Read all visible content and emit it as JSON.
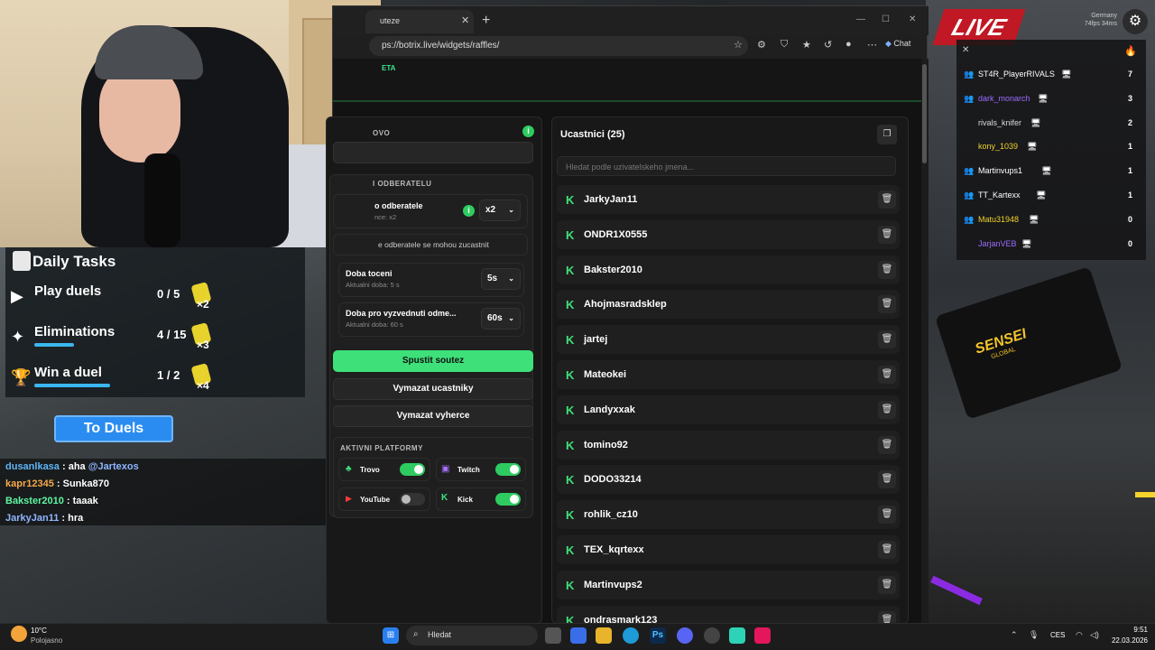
{
  "game": {
    "location": "Germany",
    "fps_ping": "74fps 34ms",
    "banner": "LIVE",
    "sensei_label": "SENSEI",
    "sensei_sub": "GLOBAL"
  },
  "daily_tasks": {
    "title": "Daily Tasks",
    "tasks": [
      {
        "label": "Play duels",
        "progress": "0 / 5",
        "multiplier": "×2",
        "fraction": 0.0
      },
      {
        "label": "Eliminations",
        "progress": "4 / 15",
        "multiplier": "×3",
        "fraction": 0.27
      },
      {
        "label": "Win a duel",
        "progress": "1 / 2",
        "multiplier": "×4",
        "fraction": 0.5
      }
    ],
    "button": "To Duels"
  },
  "chat": [
    {
      "user": "dusanlkasa",
      "text": " : aha ",
      "mention": "@Jartexos",
      "color": "#5fb4f5"
    },
    {
      "user": "kapr12345",
      "text": " : Sunka870",
      "mention": "",
      "color": "#f5a94a"
    },
    {
      "user": "Bakster2010",
      "text": " : taaak",
      "mention": "",
      "color": "#5ff5a0"
    },
    {
      "user": "JarkyJan11",
      "text": " : hra",
      "mention": "",
      "color": "#8fb6ff"
    }
  ],
  "browser": {
    "tab_title": "uteze",
    "url": "ps://botrix.live/widgets/raffles/",
    "chat_label": "Chat",
    "brand": "ETA"
  },
  "settings": {
    "top_label": "OVO",
    "section_subscribers": "I ODBERATELU",
    "subscriber_luck_label": "o odberatele",
    "subscriber_luck_sub": "nce: x2",
    "subscriber_luck_value": "x2",
    "only_subs_text": "e odberatele se mohou zucastnit",
    "spin_time_label": "Doba toceni",
    "spin_time_sub": "Aktualni doba: 5 s",
    "spin_time_value": "5s",
    "claim_time_label": "Doba pro vyzvednuti odme...",
    "claim_time_sub": "Aktualni doba: 60 s",
    "claim_time_value": "60s",
    "start_button": "Spustit soutez",
    "clear_participants": "Vymazat ucastniky",
    "clear_winners": "Vymazat vyherce",
    "platforms_head": "AKTIVNI PLATFORMY",
    "platforms": [
      {
        "name": "Trovo",
        "on": true
      },
      {
        "name": "Twitch",
        "on": true
      },
      {
        "name": "YouTube",
        "on": false
      },
      {
        "name": "Kick",
        "on": true
      }
    ]
  },
  "participants": {
    "title": "Ucastnici (25)",
    "search_placeholder": "Hledat podle uzivatelskeho jmena...",
    "list": [
      "JarkyJan11",
      "ONDR1X0555",
      "Bakster2010",
      "Ahojmasradsklep",
      "jartej",
      "Mateokei",
      "Landyxxak",
      "tomino92",
      "DODO33214",
      "rohlik_cz10",
      "TEX_kqrtexx",
      "Martinvups2",
      "ondrasmark123"
    ]
  },
  "leaderboard": [
    {
      "name": "ST4R_PlayerRIVALS",
      "score": "7",
      "color": "#ffffff"
    },
    {
      "name": "dark_monarch",
      "score": "3",
      "color": "#9b6bff"
    },
    {
      "name": "rivals_knifer",
      "score": "2",
      "color": "#dddddd"
    },
    {
      "name": "kony_1039",
      "score": "1",
      "color": "#f2d42c"
    },
    {
      "name": "Martinvups1",
      "score": "1",
      "color": "#ffffff"
    },
    {
      "name": "TT_Kartexx",
      "score": "1",
      "color": "#ffffff"
    },
    {
      "name": "Matu31948",
      "score": "0",
      "color": "#f2d42c"
    },
    {
      "name": "JarjanVEB",
      "score": "0",
      "color": "#9b6bff"
    }
  ],
  "taskbar": {
    "weather_temp": "10°C",
    "weather_desc": "Polojasno",
    "search_placeholder": "Hledat",
    "lang": "CES",
    "time": "9:51",
    "date": "22.03.2026"
  }
}
